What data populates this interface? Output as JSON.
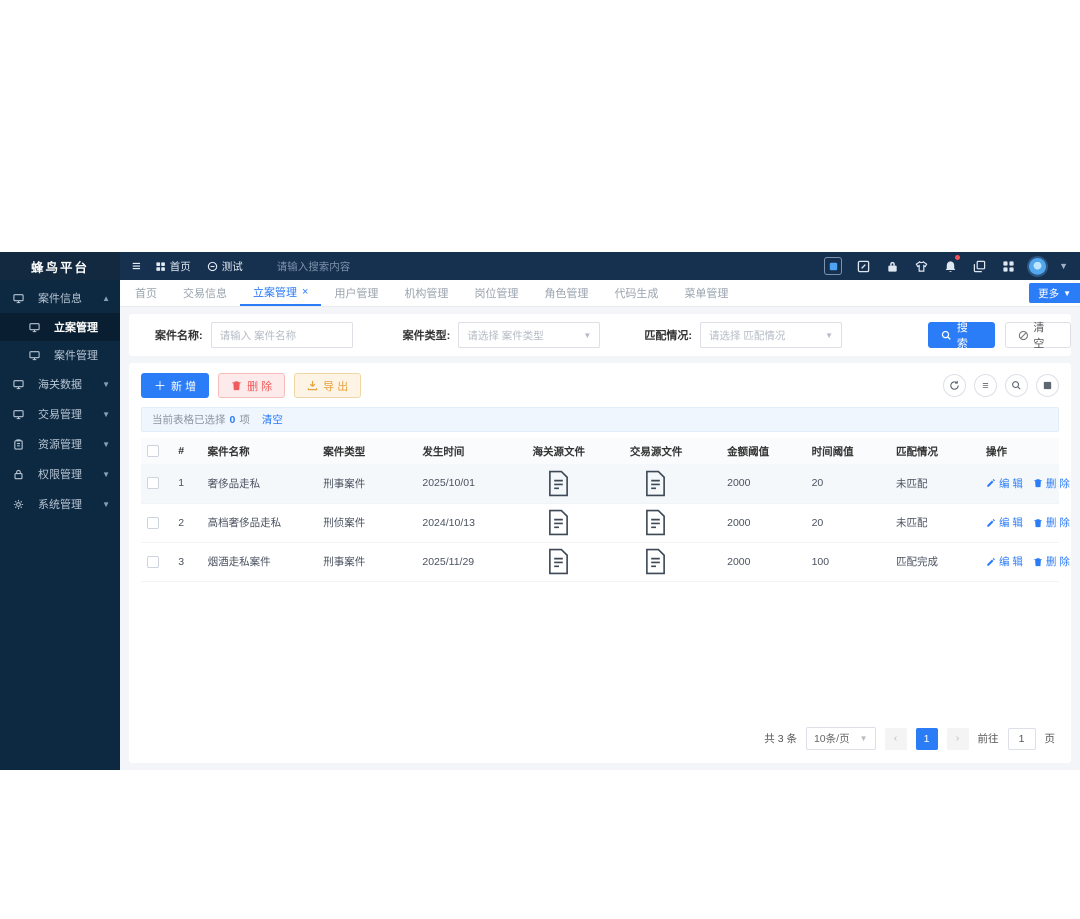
{
  "brand": {
    "title": "蜂鸟平台"
  },
  "topbar": {
    "breadcrumb": [
      {
        "icon": "grid",
        "label": "首页"
      },
      {
        "icon": "circle",
        "label": "测试"
      }
    ],
    "search_placeholder": "请输入搜索内容"
  },
  "sidebar": {
    "items": [
      {
        "label": "案件信息",
        "icon": "monitor",
        "expanded": true,
        "children": [
          {
            "label": "立案管理",
            "active": true
          },
          {
            "label": "案件管理",
            "active": false
          }
        ]
      },
      {
        "label": "海关数据",
        "icon": "monitor"
      },
      {
        "label": "交易管理",
        "icon": "monitor"
      },
      {
        "label": "资源管理",
        "icon": "clipboard"
      },
      {
        "label": "权限管理",
        "icon": "lock"
      },
      {
        "label": "系统管理",
        "icon": "gear"
      }
    ]
  },
  "tabs": {
    "items": [
      {
        "label": "首页"
      },
      {
        "label": "交易信息"
      },
      {
        "label": "立案管理",
        "active": true,
        "closable": true
      },
      {
        "label": "用户管理"
      },
      {
        "label": "机构管理"
      },
      {
        "label": "岗位管理"
      },
      {
        "label": "角色管理"
      },
      {
        "label": "代码生成"
      },
      {
        "label": "菜单管理"
      }
    ],
    "more_label": "更多"
  },
  "filters": {
    "name": {
      "label": "案件名称:",
      "placeholder": "请输入 案件名称"
    },
    "type": {
      "label": "案件类型:",
      "placeholder": "请选择 案件类型"
    },
    "match": {
      "label": "匹配情况:",
      "placeholder": "请选择 匹配情况"
    },
    "search_label": "搜 索",
    "clear_label": "清 空"
  },
  "toolbar": {
    "add_label": "新 增",
    "delete_label": "删 除",
    "export_label": "导 出"
  },
  "selection_bar": {
    "prefix": "当前表格已选择",
    "count": "0",
    "suffix": "项",
    "clear_label": "清空"
  },
  "table": {
    "columns": [
      "",
      "#",
      "案件名称",
      "案件类型",
      "发生时间",
      "海关源文件",
      "交易源文件",
      "金额阈值",
      "时间阈值",
      "匹配情况",
      "操作"
    ],
    "edit_label": "编 辑",
    "delete_label": "删 除",
    "rows": [
      {
        "index": "1",
        "name": "奢侈品走私",
        "type": "刑事案件",
        "date": "2025/10/01",
        "amount": "2000",
        "time": "20",
        "match": "未匹配",
        "shaded": true
      },
      {
        "index": "2",
        "name": "高档奢侈品走私",
        "type": "刑侦案件",
        "date": "2024/10/13",
        "amount": "2000",
        "time": "20",
        "match": "未匹配",
        "shaded": false
      },
      {
        "index": "3",
        "name": "烟酒走私案件",
        "type": "刑事案件",
        "date": "2025/11/29",
        "amount": "2000",
        "time": "100",
        "match": "匹配完成",
        "shaded": false
      }
    ]
  },
  "pagination": {
    "total": "共 3 条",
    "page_size": "10条/页",
    "current_page": "1",
    "goto_label": "前往",
    "goto_value": "1",
    "page_unit": "页"
  },
  "colors": {
    "accent": "#2b7cf7",
    "topbar_bg": "#16304f",
    "sidebar_bg": "#0d2942",
    "danger": "#f05b5b",
    "warning": "#e6a23c"
  }
}
